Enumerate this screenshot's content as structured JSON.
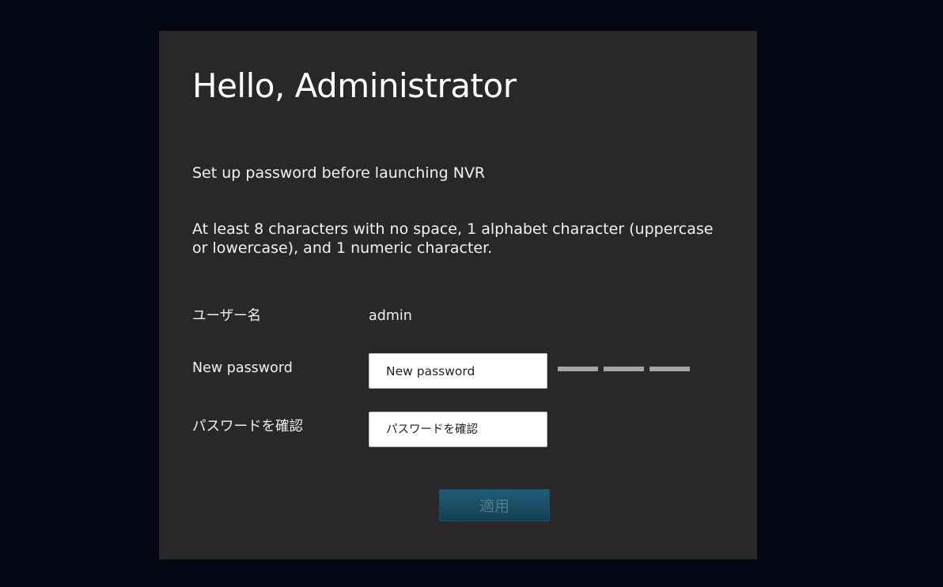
{
  "dialog": {
    "title": "Hello, Administrator",
    "subtitle": "Set up password before launching NVR",
    "rules": "At least 8 characters with no space, 1 alphabet character (uppercase or lowercase), and 1 numeric character."
  },
  "form": {
    "username": {
      "label": "ユーザー名",
      "value": "admin"
    },
    "new_password": {
      "label": "New password",
      "placeholder": "New password",
      "value": ""
    },
    "confirm_password": {
      "label": "パスワードを確認",
      "placeholder": "パスワードを確認",
      "value": ""
    },
    "strength_meter": {
      "segments": 3,
      "filled": 0,
      "color": "#a5a5a5"
    }
  },
  "actions": {
    "apply_label": "適用",
    "apply_enabled": false
  },
  "colors": {
    "background": "#050714",
    "panel": "#282828",
    "button": "#1b4d66"
  }
}
